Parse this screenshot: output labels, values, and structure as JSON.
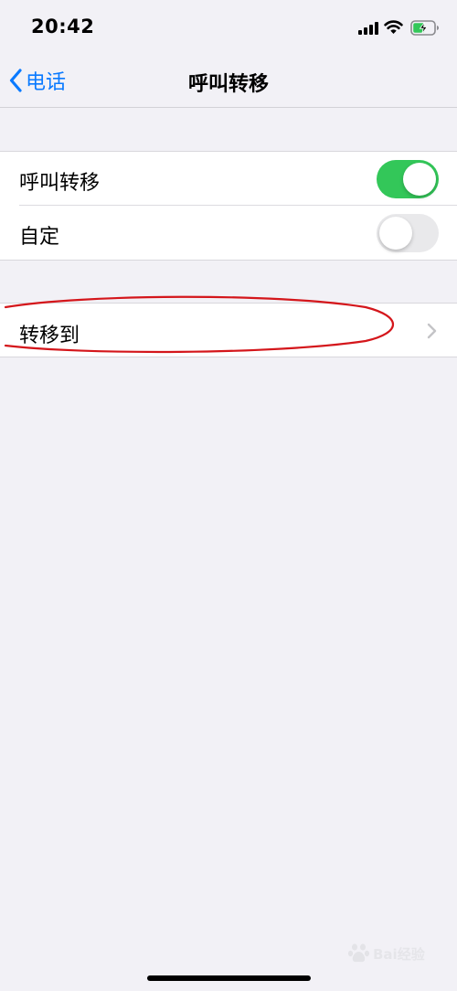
{
  "status_bar": {
    "time": "20:42",
    "icons": [
      "signal-icon",
      "wifi-icon",
      "battery-charging-icon"
    ]
  },
  "nav": {
    "back_label": "电话",
    "back_icon": "chevron-left-icon",
    "title": "呼叫转移"
  },
  "settings": {
    "call_forwarding": {
      "label": "呼叫转移",
      "on": true
    },
    "custom": {
      "label": "自定",
      "on": false
    },
    "forward_to": {
      "label": "转移到",
      "icon": "chevron-right-icon"
    }
  },
  "watermark": {
    "text": "Bai经验"
  },
  "colors": {
    "accent": "#0a7aff",
    "toggle_on": "#33c759",
    "toggle_off": "#e9e9eb",
    "background": "#f2f1f6",
    "highlight": "#d4161b"
  }
}
